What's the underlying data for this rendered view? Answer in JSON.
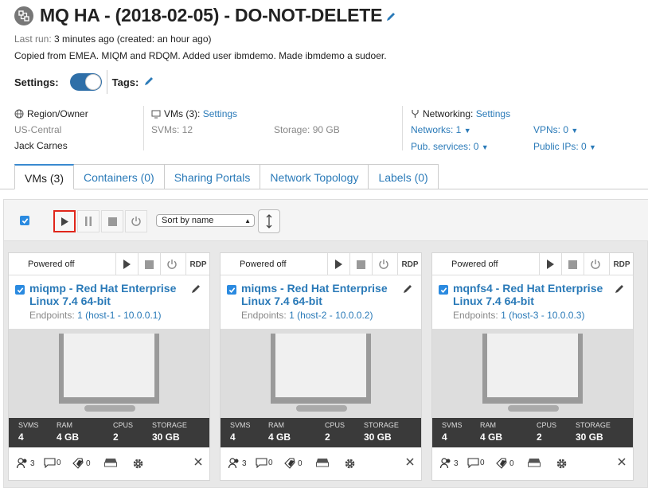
{
  "header": {
    "title": "MQ HA - (2018-02-05) - DO-NOT-DELETE",
    "last_run_label": "Last run:",
    "last_run_value": "3 minutes ago (created: an hour ago)",
    "description": "Copied from EMEA. MIQM and RDQM. Added user ibmdemo. Made ibmdemo a sudoer.",
    "settings_label": "Settings:",
    "tags_label": "Tags:"
  },
  "info": {
    "region_label": "Region/Owner",
    "region": "US-Central",
    "owner": "Jack Carnes",
    "vms_label": "VMs (3):",
    "vms_link": "Settings",
    "svms": "SVMs: 12",
    "storage": "Storage: 90 GB",
    "networking_label": "Networking:",
    "networking_link": "Settings",
    "networks": "Networks: 1",
    "pub_services": "Pub. services: 0",
    "vpns": "VPNs: 0",
    "public_ips": "Public IPs: 0"
  },
  "tabs": [
    {
      "label": "VMs (3)"
    },
    {
      "label": "Containers (0)"
    },
    {
      "label": "Sharing Portals"
    },
    {
      "label": "Network Topology"
    },
    {
      "label": "Labels (0)"
    }
  ],
  "toolbar": {
    "sort_value": "Sort by name"
  },
  "colors": {
    "accent": "#2a7ab8",
    "highlight": "#e0261b"
  },
  "vms": [
    {
      "status": "Powered off",
      "rdp": "RDP",
      "name": "miqmp - Red Hat Enterprise Linux 7.4 64-bit",
      "endpoints_label": "Endpoints:",
      "endpoints_value": "1 (host-1 - 10.0.0.1)",
      "svms_label": "SVMS",
      "svms": "4",
      "ram_label": "RAM",
      "ram": "4 GB",
      "cpus_label": "CPUS",
      "cpus": "2",
      "storage_label": "STORAGE",
      "storage": "30 GB",
      "users": "3",
      "comments": "0",
      "tags": "0"
    },
    {
      "status": "Powered off",
      "rdp": "RDP",
      "name": "miqms - Red Hat Enterprise Linux 7.4 64-bit",
      "endpoints_label": "Endpoints:",
      "endpoints_value": "1 (host-2 - 10.0.0.2)",
      "svms_label": "SVMS",
      "svms": "4",
      "ram_label": "RAM",
      "ram": "4 GB",
      "cpus_label": "CPUS",
      "cpus": "2",
      "storage_label": "STORAGE",
      "storage": "30 GB",
      "users": "3",
      "comments": "0",
      "tags": "0"
    },
    {
      "status": "Powered off",
      "rdp": "RDP",
      "name": "mqnfs4 - Red Hat Enterprise Linux 7.4 64-bit",
      "endpoints_label": "Endpoints:",
      "endpoints_value": "1 (host-3 - 10.0.0.3)",
      "svms_label": "SVMS",
      "svms": "4",
      "ram_label": "RAM",
      "ram": "4 GB",
      "cpus_label": "CPUS",
      "cpus": "2",
      "storage_label": "STORAGE",
      "storage": "30 GB",
      "users": "3",
      "comments": "0",
      "tags": "0"
    }
  ]
}
